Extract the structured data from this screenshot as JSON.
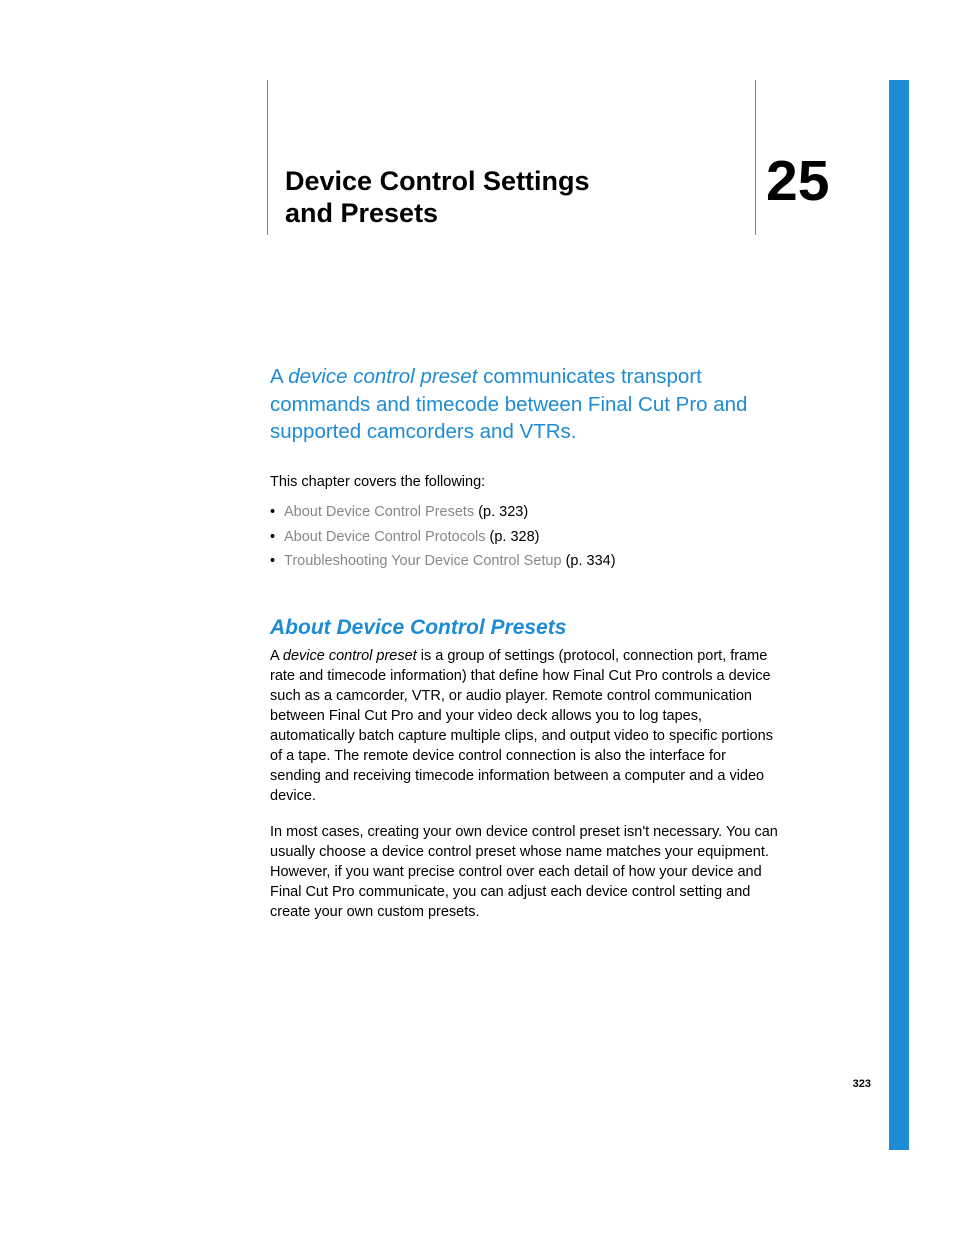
{
  "chapter": {
    "title_line1": "Device Control Settings",
    "title_line2": "and Presets",
    "number": "25"
  },
  "intro": {
    "prefix": "A ",
    "italic_term": "device control preset",
    "suffix": " communicates transport commands and timecode between Final Cut Pro and supported camcorders and VTRs."
  },
  "covers_label": "This chapter covers the following:",
  "toc": [
    {
      "link": "About Device Control Presets",
      "page": " (p. 323)"
    },
    {
      "link": "About Device Control Protocols",
      "page": " (p. 328)"
    },
    {
      "link": "Troubleshooting Your Device Control Setup",
      "page": " (p. 334)"
    }
  ],
  "section": {
    "heading": "About Device Control Presets",
    "para1_prefix": "A ",
    "para1_italic": "device control preset",
    "para1_suffix": " is a group of settings (protocol, connection port, frame rate and timecode information) that define how Final Cut Pro controls a device such as a camcorder, VTR, or audio player. Remote control communication between Final Cut Pro and your video deck allows you to log tapes, automatically batch capture multiple clips, and output video to specific portions of a tape. The remote device control connection is also the interface for sending and receiving timecode information between a computer and a video device.",
    "para2": "In most cases, creating your own device control preset isn't necessary. You can usually choose a device control preset whose name matches your equipment. However, if you want precise control over each detail of how your device and Final Cut Pro communicate, you can adjust each device control setting and create your own custom presets."
  },
  "page_number": "323"
}
